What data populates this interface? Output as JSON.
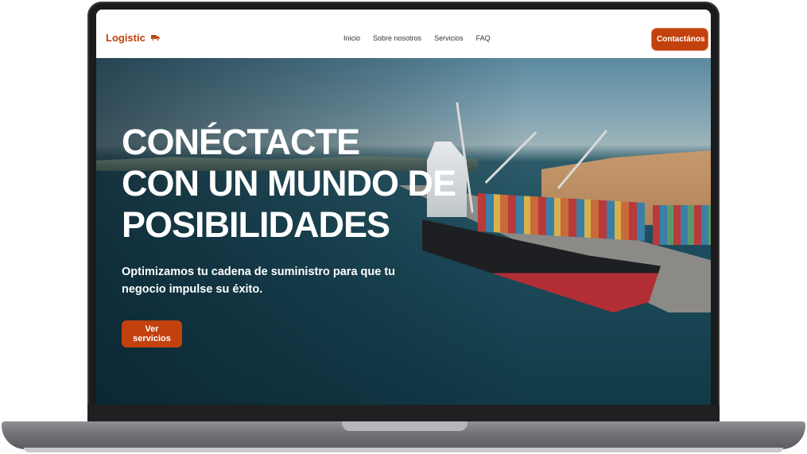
{
  "nav": {
    "logo": "Logistic",
    "logo_icon": "truck-icon",
    "links": [
      "Inicio",
      "Sobre nosotros",
      "Servicios",
      "FAQ"
    ],
    "contact_label": "Contactános"
  },
  "hero": {
    "title_lines": [
      "CONÉCTACTE",
      "CON UN MUNDO DE",
      "POSIBILIDADES"
    ],
    "subtitle": "Optimizamos tu cadena de suministro para que tu negocio impulse su éxito.",
    "cta_label": "Ver servicios"
  },
  "colors": {
    "accent": "#c2410c",
    "text_on_hero": "#ffffff"
  }
}
